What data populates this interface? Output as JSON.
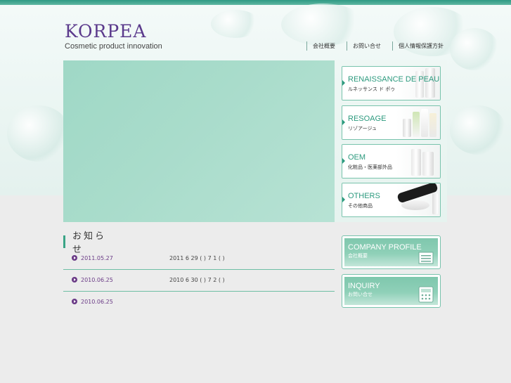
{
  "brand": {
    "logo": "KORPEA",
    "tagline": "Cosmetic product innovation"
  },
  "nav": [
    {
      "label": "会社概要"
    },
    {
      "label": "お問い合せ"
    },
    {
      "label": "個人情報保護方針"
    }
  ],
  "products": [
    {
      "title": "RENAISSANCE DE PEAU",
      "sub": "ルネッサンス ド ポゥ"
    },
    {
      "title": "RESOAGE",
      "sub": "リゾアージュ"
    },
    {
      "title": "OEM",
      "sub": "化粧品・医薬部外品"
    },
    {
      "title": "OTHERS",
      "sub": "その他商品"
    }
  ],
  "news": {
    "title": "お知らせ",
    "items": [
      {
        "date": "2011.05.27",
        "text": "2011 6 29 ( ) 7 1 ( )"
      },
      {
        "date": "2010.06.25",
        "text": "2010 6 30 ( ) 7 2 ( )"
      },
      {
        "date": "2010.06.25",
        "text": ""
      }
    ]
  },
  "banners": [
    {
      "title": "COMPANY PROFILE",
      "sub": "会社概要",
      "icon": "building-icon"
    },
    {
      "title": "INQUIRY",
      "sub": "お問い合せ",
      "icon": "phone-icon"
    }
  ],
  "colors": {
    "stripe": "#2f9a84",
    "accent": "#2c9a7e",
    "logo": "#5b3a8c",
    "date": "#6a3a86",
    "hero": "#a9dccb"
  }
}
